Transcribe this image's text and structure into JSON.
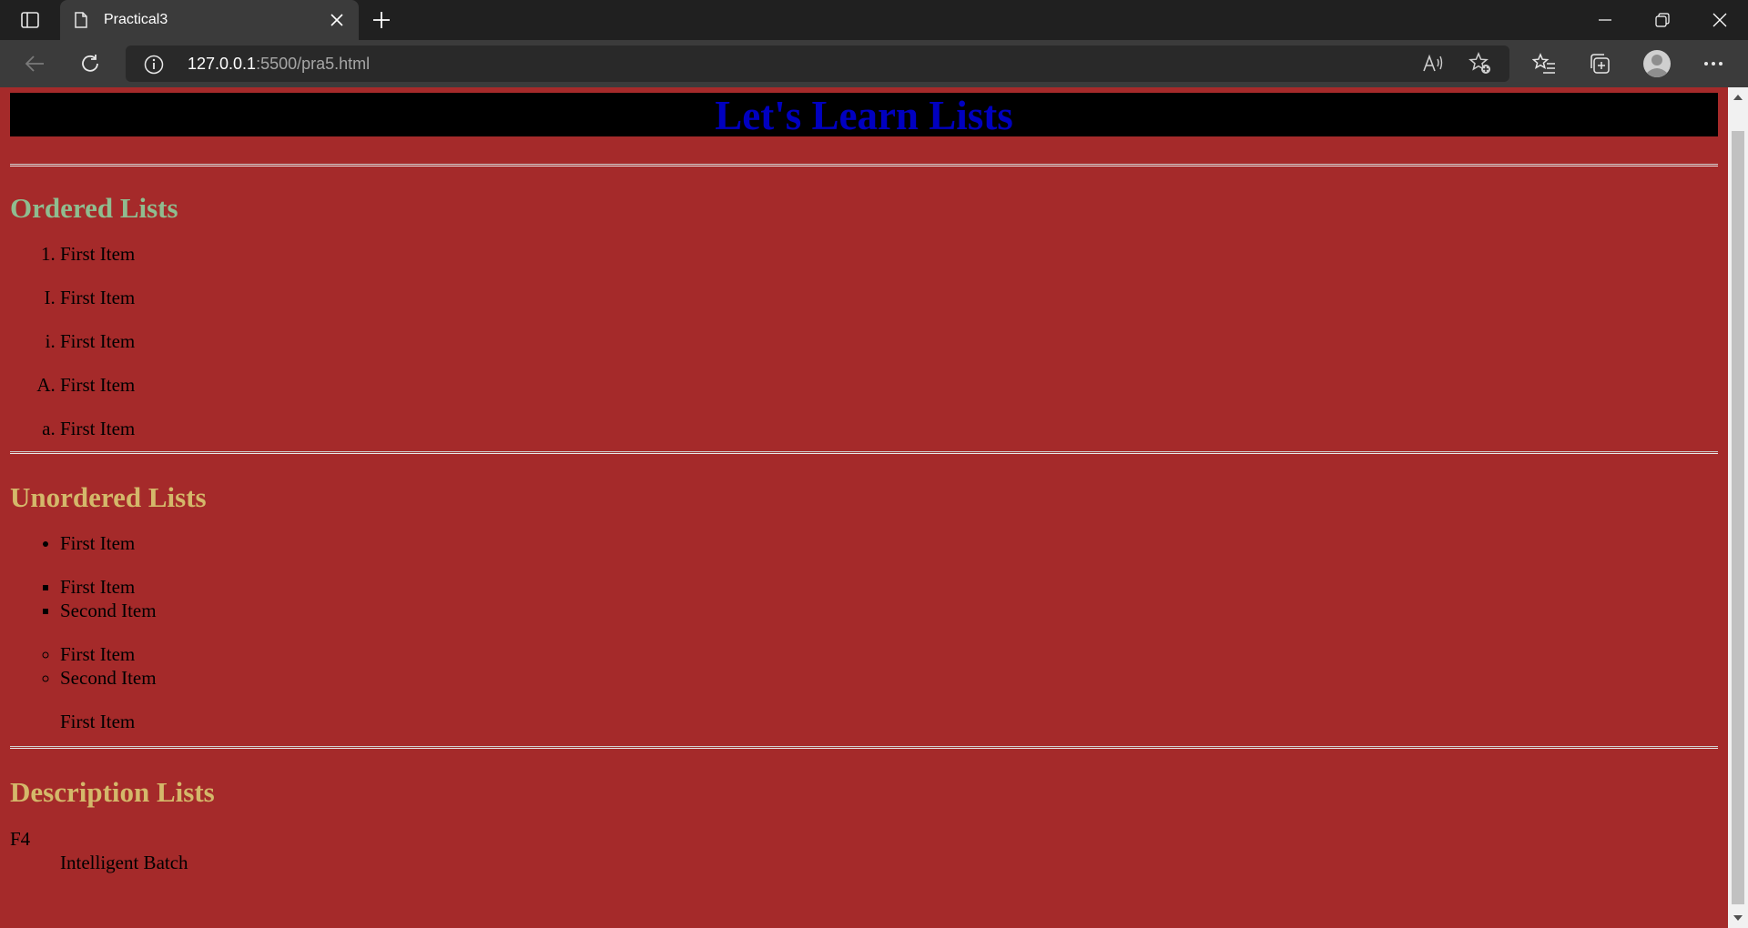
{
  "browser": {
    "tab_title": "Practical3",
    "url_host": "127.0.0.1",
    "url_path": ":5500/pra5.html"
  },
  "page": {
    "banner_title": "Let's Learn Lists",
    "ordered": {
      "heading": "Ordered Lists",
      "lists": [
        {
          "type": "1",
          "items": [
            "First Item"
          ]
        },
        {
          "type": "I",
          "items": [
            "First Item"
          ]
        },
        {
          "type": "i",
          "items": [
            "First Item"
          ]
        },
        {
          "type": "A",
          "items": [
            "First Item"
          ]
        },
        {
          "type": "a",
          "items": [
            "First Item"
          ]
        }
      ]
    },
    "unordered": {
      "heading": "Unordered Lists",
      "lists": [
        {
          "style": "disc",
          "items": [
            "First Item"
          ]
        },
        {
          "style": "square",
          "items": [
            "First Item",
            "Second Item"
          ]
        },
        {
          "style": "circle",
          "items": [
            "First Item",
            "Second Item"
          ]
        },
        {
          "style": "none",
          "items": [
            "First Item"
          ]
        }
      ]
    },
    "description": {
      "heading": "Description Lists",
      "term": "F4",
      "definition": "Intelligent Batch"
    }
  },
  "colors": {
    "page_background": "#a52a2a",
    "banner_background": "#000000",
    "banner_text": "#0000c0",
    "ordered_heading": "#8fbc8f",
    "other_headings": "#d4b86a"
  }
}
